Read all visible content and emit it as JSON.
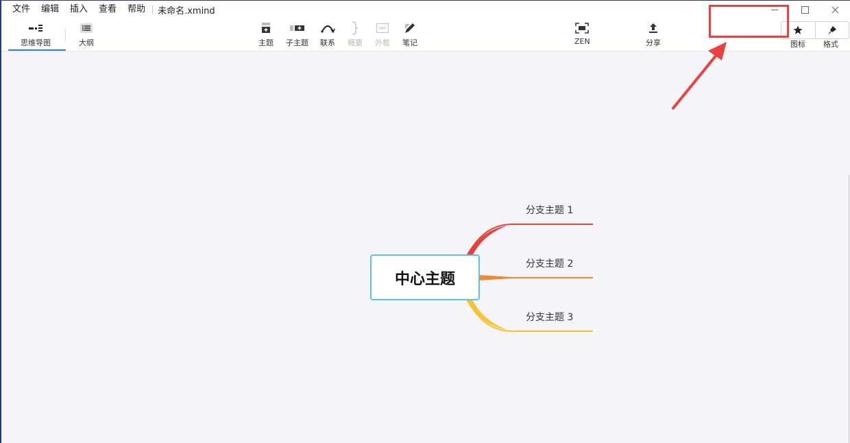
{
  "menu": {
    "items": [
      "文件",
      "编辑",
      "插入",
      "查看",
      "帮助"
    ],
    "doc_title": "未命名.xmind"
  },
  "view_tabs": {
    "mindmap_label": "思维导图",
    "outline_label": "大纲"
  },
  "toolbar": {
    "topic_label": "主题",
    "subtopic_label": "子主题",
    "relationship_label": "联系",
    "summary_label": "概要",
    "boundary_label": "外框",
    "note_label": "笔记",
    "zen_label": "ZEN",
    "share_label": "分享",
    "icon_label": "图标",
    "format_label": "格式"
  },
  "mindmap": {
    "central_topic": "中心主题",
    "branches": [
      {
        "label": "分支主题 1",
        "color": "#e8413a"
      },
      {
        "label": "分支主题 2",
        "color": "#f0892a"
      },
      {
        "label": "分支主题 3",
        "color": "#f8c230"
      }
    ]
  },
  "annotation": {
    "color": "#e94040"
  },
  "colors": {
    "accent": "#2a82e4",
    "central_border": "#5cc0ee",
    "canvas_bg": "#f5f5f9"
  }
}
